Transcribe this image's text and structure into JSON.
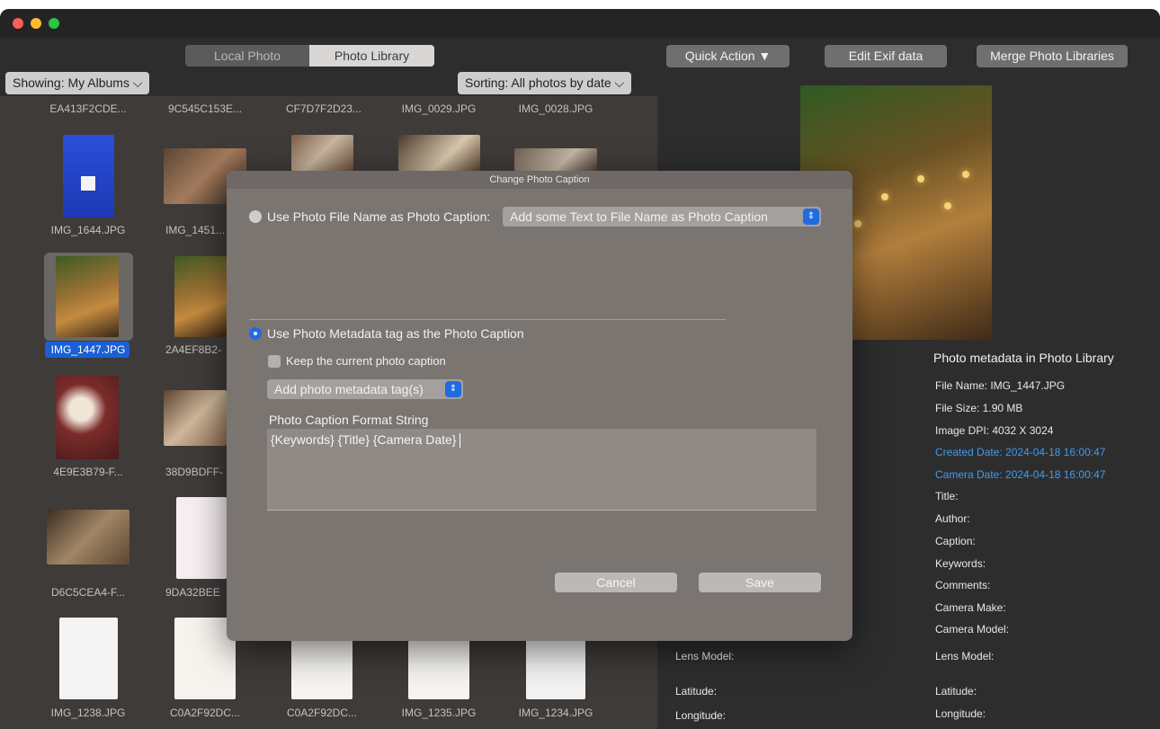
{
  "toolbar": {
    "seg_local": "Local Photo",
    "seg_library": "Photo Library",
    "quick_action": "Quick Action ▼",
    "edit_exif": "Edit Exif data",
    "merge": "Merge Photo Libraries"
  },
  "filters": {
    "showing": "Showing: My Albums ⌵",
    "sorting": "Sorting: All photos by date ⌵"
  },
  "grid": {
    "row0": [
      "EA413F2CDE...",
      "9C545C153E...",
      "CF7D7F2D23...",
      "IMG_0029.JPG",
      "IMG_0028.JPG"
    ],
    "row1": [
      "IMG_1644.JPG",
      "IMG_1451..."
    ],
    "row2": [
      "IMG_1447.JPG",
      "2A4EF8B2-"
    ],
    "row3": [
      "4E9E3B79-F...",
      "38D9BDFF-"
    ],
    "row4": [
      "D6C5CEA4-F...",
      "9DA32BEE"
    ],
    "row5": [
      "IMG_1238.JPG",
      "C0A2F92DC...",
      "C0A2F92DC...",
      "IMG_1235.JPG",
      "IMG_1234.JPG"
    ],
    "selected": "IMG_1447.JPG"
  },
  "metadata": {
    "heading": "Photo metadata in Photo Library",
    "rows": [
      "File Name: IMG_1447.JPG",
      "File Size: 1.90 MB",
      "Image DPI: 4032 X 3024",
      "Created Date: 2024-04-18 16:00:47",
      "Camera Date: 2024-04-18 16:00:47",
      "Title:",
      "Author:",
      "Caption:",
      "Keywords:",
      "Comments:",
      "Camera Make:",
      "Camera Model:",
      "Lens Model:",
      "Latitude:",
      "Longitude:"
    ],
    "highlight_color": "#3e9cf1",
    "left_lens": "Lens Model:",
    "left_latitude": "Latitude:",
    "left_longitude": "Longitude:"
  },
  "dialog": {
    "title": "Change Photo Caption",
    "option1_label": "Use Photo File Name as Photo Caption:",
    "option1_popup": "Add some Text to File Name as Photo Caption",
    "option2_label": "Use Photo Metadata tag as the Photo Caption",
    "keep_caption": "Keep the current photo caption",
    "add_tag_popup": "Add photo metadata tag(s)",
    "format_label": "Photo Caption Format String",
    "format_value": "{Keywords} {Title} {Camera Date}",
    "cancel": "Cancel",
    "save": "Save",
    "selected_option": 2
  },
  "colors": {
    "accent": "#1f6be0",
    "selection": "#1b5fd6",
    "window_bg": "#2e2d2e"
  }
}
